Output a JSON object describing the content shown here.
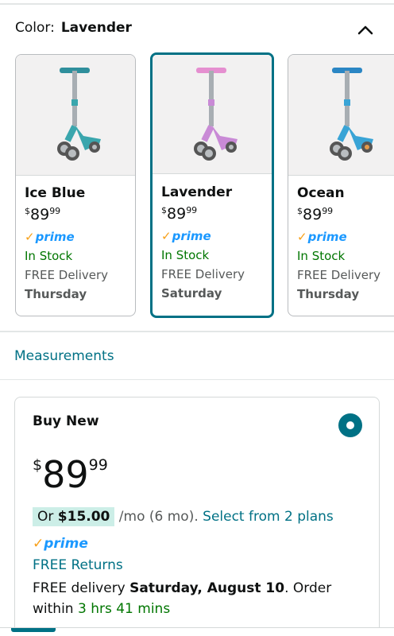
{
  "color_selector": {
    "label": "Color:",
    "selected": "Lavender",
    "collapse_icon": "chevron-up-icon"
  },
  "options": [
    {
      "name": "Ice Blue",
      "price_symbol": "$",
      "price_whole": "89",
      "price_fraction": "99",
      "prime": "prime",
      "stock": "In Stock",
      "delivery": "FREE Delivery",
      "day": "Thursday",
      "color": "#3aa6ad"
    },
    {
      "name": "Lavender",
      "price_symbol": "$",
      "price_whole": "89",
      "price_fraction": "99",
      "prime": "prime",
      "stock": "In Stock",
      "delivery": "FREE Delivery",
      "day": "Saturday",
      "color": "#c98ad6"
    },
    {
      "name": "Ocean",
      "price_symbol": "$",
      "price_whole": "89",
      "price_fraction": "99",
      "prime": "prime",
      "stock": "In Stock",
      "delivery": "FREE Delivery",
      "day": "Thursday",
      "color": "#39a4d6"
    }
  ],
  "measurements_link": "Measurements",
  "buy_box": {
    "title": "Buy New",
    "price_symbol": "$",
    "price_whole": "89",
    "price_fraction": "99",
    "monthly_prefix": "Or",
    "monthly_amount": "$15.00",
    "monthly_suffix": "/mo (6 mo).",
    "plans_link": "Select from 2 plans",
    "prime": "prime",
    "returns": "FREE Returns",
    "delivery_prefix": "FREE delivery",
    "delivery_date": "Saturday, August 10",
    "delivery_mid": ". Order within",
    "order_within": "3 hrs 41 mins"
  }
}
